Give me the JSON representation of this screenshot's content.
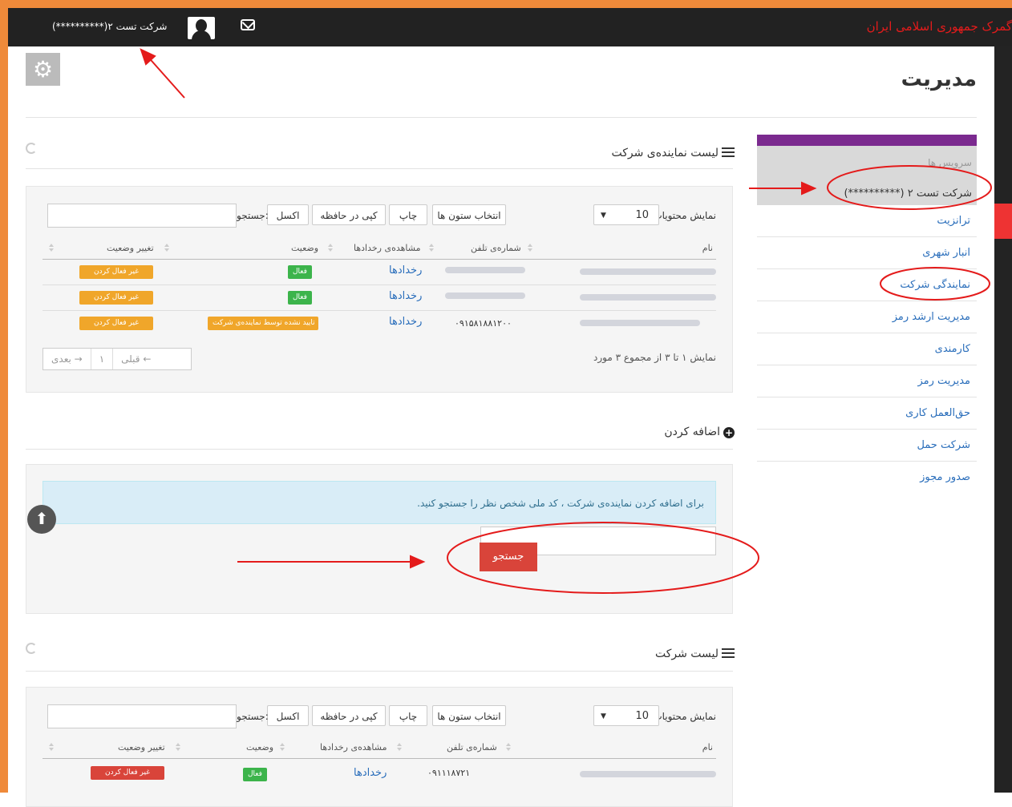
{
  "topbar": {
    "brand": "گمرک جمهوری اسلامی ایران",
    "user_label": "شرکت تست ۲(**********)",
    "avatar_icon": "user-avatar-icon",
    "mail_icon": "envelope-icon"
  },
  "page": {
    "title": "مدیریت",
    "settings_icon": "gear-icon"
  },
  "sidebar": {
    "active_faded": "سرویس ها",
    "active_label": "شرکت تست ۲ (**********)",
    "items": [
      {
        "label": "ترانزیت"
      },
      {
        "label": "انبار شهری"
      },
      {
        "label": "نمایندگی شرکت"
      },
      {
        "label": "مدیریت ارشد رمز"
      },
      {
        "label": "کارمندی"
      },
      {
        "label": "مدیریت رمز"
      },
      {
        "label": "حق‌العمل کاری"
      },
      {
        "label": "شرکت حمل"
      },
      {
        "label": "صدور مجوز"
      }
    ]
  },
  "section1": {
    "title": "لیست نماینده‌ی شرکت",
    "show_entries_label": "نمایش محتویات",
    "page_size": "10",
    "buttons": {
      "columns": "انتخاب ستون ها",
      "print": "چاپ",
      "copy": "کپی در حافظه",
      "excel": "اکسل"
    },
    "search_label": "جستجو:",
    "headers": {
      "name": "نام",
      "phone": "شماره‌ی تلفن",
      "view_events": "مشاهده‌ی رخدادها",
      "status": "وضعیت",
      "change_status": "تغییر وضعیت"
    },
    "rows": [
      {
        "phone": "",
        "events": "رخدادها",
        "status": "فعال",
        "action": "غیر فعال کردن"
      },
      {
        "phone": "",
        "events": "رخدادها",
        "status": "فعال",
        "action": "غیر فعال کردن"
      },
      {
        "phone": "۰۹۱۵۸۱۸۸۱۲۰۰",
        "events": "رخدادها",
        "status": "تایید نشده توسط نماینده‌ی شرکت",
        "action": "غیر فعال کردن"
      }
    ],
    "info": "نمایش ۱ تا ۳ از مجموع ۳ مورد",
    "pager": {
      "prev": "قبلی ←",
      "page": "۱",
      "next": "بعدی →"
    }
  },
  "add_section": {
    "title": "اضافه کردن",
    "info": "برای اضافه کردن نماینده‌ی شرکت ، کد ملی شخص نظر را جستجو کنید.",
    "search_button": "جستجو",
    "search_value": ""
  },
  "section2": {
    "title": "لیست شرکت",
    "show_entries_label": "نمایش محتویات",
    "page_size": "10",
    "buttons": {
      "columns": "انتخاب ستون ها",
      "print": "چاپ",
      "copy": "کپی در حافظه",
      "excel": "اکسل"
    },
    "search_label": "جستجو:",
    "headers": {
      "name": "نام",
      "phone": "شماره‌ی تلفن",
      "view_events": "مشاهده‌ی رخدادها",
      "status": "وضعیت",
      "change_status": "تغییر وضعیت"
    },
    "rows": [
      {
        "phone": "۰۹۱۱۱۸۷۲۱",
        "events": "رخدادها",
        "status": "فعال",
        "action": "غیر فعال کردن"
      }
    ]
  },
  "colors": {
    "topbar": "#222222",
    "brand": "#e41b1b",
    "frame": "#ef8a3a",
    "sidebar_accent": "#7b2a8f",
    "link": "#2a6ebb",
    "badge_green": "#3cb44b",
    "badge_orange": "#f0a62a",
    "badge_red": "#d9443a",
    "annotation_red": "#e41b1b"
  }
}
